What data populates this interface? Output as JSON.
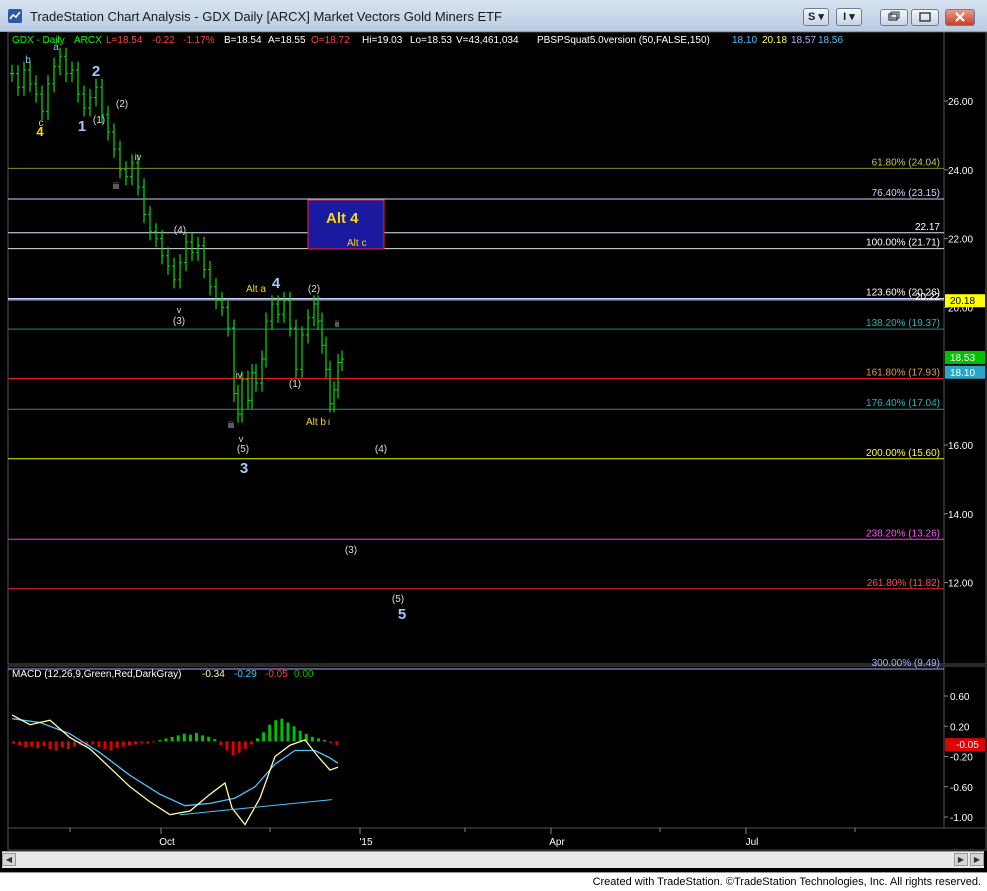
{
  "window": {
    "title": "TradeStation Chart Analysis - GDX Daily [ARCX] Market Vectors Gold Miners ETF",
    "btn_s": "S",
    "btn_i": "I"
  },
  "header": {
    "symbol": "GDX - Daily",
    "exchange": "ARCX",
    "last": "L=18.54",
    "change": "-0.22",
    "pct": "-1.17%",
    "bid": "B=18.54",
    "ask": "A=18.55",
    "open": "O=18.72",
    "high": "Hi=19.03",
    "low": "Lo=18.53",
    "volume": "V=43,461,034",
    "study": "PBSPSquat5.0version (50,FALSE,150)",
    "sv1": "18.10",
    "sv2": "20.18",
    "sv3": "18.57",
    "sv4": "18.56"
  },
  "macd_header": {
    "label": "MACD (12,26,9,Green,Red,DarkGray)",
    "v1": "-0.34",
    "v2": "-0.29",
    "v3": "-0.05",
    "v4": "0.00"
  },
  "price_axis": {
    "ticks": [
      {
        "label": "26.00",
        "value": 26
      },
      {
        "label": "24.00",
        "value": 24
      },
      {
        "label": "22.00",
        "value": 22
      },
      {
        "label": "20.00",
        "value": 20
      },
      {
        "label": "16.00",
        "value": 16
      },
      {
        "label": "14.00",
        "value": 14
      },
      {
        "label": "12.00",
        "value": 12
      }
    ],
    "tags": [
      {
        "label": "20.18",
        "value": 20.18,
        "bg": "#ffff00",
        "fg": "#000"
      },
      {
        "label": "18.53",
        "value": 18.53,
        "bg": "#00c000",
        "fg": "#fff"
      },
      {
        "label": "18.10",
        "value": 18.1,
        "bg": "#2aa6c8",
        "fg": "#fff"
      }
    ]
  },
  "macd_axis": {
    "ticks": [
      {
        "label": "0.60",
        "value": 0.6
      },
      {
        "label": "0.20",
        "value": 0.2
      },
      {
        "label": "-0.20",
        "value": -0.2
      },
      {
        "label": "-0.60",
        "value": -0.6
      },
      {
        "label": "-1.00",
        "value": -1.0
      }
    ],
    "tag": {
      "label": "-0.05",
      "value": -0.05
    }
  },
  "date_axis": [
    "Oct",
    "'15",
    "Apr",
    "Jul"
  ],
  "fib_levels": [
    {
      "label": "61.80% (24.04)",
      "value": 24.04,
      "color": "#8a8a2a",
      "text": "#c9c94a"
    },
    {
      "label": "76.40% (23.15)",
      "value": 23.15,
      "color": "#c8d2ff",
      "text": "#c8d2ff"
    },
    {
      "label": "22.17",
      "value": 22.17,
      "color": "#dfe6ff",
      "text": "#ffffff"
    },
    {
      "label": "100.00% (21.71)",
      "value": 21.71,
      "color": "#dddddd",
      "text": "#ffffff"
    },
    {
      "label": "123.60% (20.26)",
      "value": 20.26,
      "color": "#c8d2ff",
      "text": "#ffffff"
    },
    {
      "label": "20.22",
      "value": 20.22,
      "color": "#e6ecff",
      "text": "#ffffff"
    },
    {
      "label": "138.20% (19.37)",
      "value": 19.37,
      "color": "#2a8a8a",
      "text": "#2fb3b3"
    },
    {
      "label": "161.80% (17.93)",
      "value": 17.93,
      "color": "#ff2020",
      "text": "#d9a04a"
    },
    {
      "label": "176.40% (17.04)",
      "value": 17.04,
      "color": "#2a8a8a",
      "text": "#2fb3b3"
    },
    {
      "label": "200.00% (15.60)",
      "value": 15.6,
      "color": "#f0f000",
      "text": "#ffff40"
    },
    {
      "label": "238.20% (13.26)",
      "value": 13.26,
      "color": "#ff30ff",
      "text": "#ff50ff"
    },
    {
      "label": "261.80% (11.82)",
      "value": 11.82,
      "color": "#ff2020",
      "text": "#ff5050"
    },
    {
      "label": "300.00% (9.49)",
      "value": 9.49,
      "color": "#9fb0ff",
      "text": "#9fb0ff"
    }
  ],
  "wave_labels": [
    {
      "text": "4",
      "color": "#ffd700",
      "size": 13,
      "bold": true
    },
    {
      "text": "c",
      "color": "#ffd700",
      "size": 10,
      "bold": false
    },
    {
      "text": "b",
      "color": "#aab8ff",
      "size": 10,
      "bold": false
    },
    {
      "text": "a",
      "color": "#aab8ff",
      "size": 10,
      "bold": false
    },
    {
      "text": "1",
      "color": "#aac4ff",
      "size": 15,
      "bold": true
    },
    {
      "text": "2",
      "color": "#aac4ff",
      "size": 15,
      "bold": true
    },
    {
      "text": "(1)",
      "color": "#dddddd",
      "size": 10,
      "bold": false
    },
    {
      "text": "(2)",
      "color": "#dddddd",
      "size": 10,
      "bold": false
    },
    {
      "text": "iii",
      "color": "#dddddd",
      "size": 9,
      "bold": false
    },
    {
      "text": "iv",
      "color": "#dddddd",
      "size": 9,
      "bold": false
    },
    {
      "text": "(4)",
      "color": "#dddddd",
      "size": 10,
      "bold": false
    },
    {
      "text": "v",
      "color": "#dddddd",
      "size": 9,
      "bold": false
    },
    {
      "text": "(3)",
      "color": "#dddddd",
      "size": 10,
      "bold": false
    },
    {
      "text": "Alt a",
      "color": "#ffd700",
      "size": 10,
      "bold": false
    },
    {
      "text": "4",
      "color": "#aac4ff",
      "size": 15,
      "bold": true
    },
    {
      "text": "(2)",
      "color": "#dddddd",
      "size": 10,
      "bold": false
    },
    {
      "text": "ii",
      "color": "#dddddd",
      "size": 9,
      "bold": false
    },
    {
      "text": "iv",
      "color": "#dddddd",
      "size": 9,
      "bold": false
    },
    {
      "text": "(1)",
      "color": "#dddddd",
      "size": 10,
      "bold": false
    },
    {
      "text": "Alt b",
      "color": "#ffd700",
      "size": 10,
      "bold": false
    },
    {
      "text": "i",
      "color": "#dddddd",
      "size": 9,
      "bold": false
    },
    {
      "text": "iii",
      "color": "#dddddd",
      "size": 9,
      "bold": false
    },
    {
      "text": "v",
      "color": "#dddddd",
      "size": 9,
      "bold": false
    },
    {
      "text": "(5)",
      "color": "#dddddd",
      "size": 10,
      "bold": false
    },
    {
      "text": "3",
      "color": "#aac4ff",
      "size": 15,
      "bold": true
    },
    {
      "text": "(4)",
      "color": "#dddddd",
      "size": 10,
      "bold": false
    },
    {
      "text": "(3)",
      "color": "#dddddd",
      "size": 10,
      "bold": false
    },
    {
      "text": "(5)",
      "color": "#dddddd",
      "size": 10,
      "bold": false
    },
    {
      "text": "5",
      "color": "#aac4ff",
      "size": 15,
      "bold": true
    }
  ],
  "alt_box": {
    "title": "Alt 4",
    "sub": "Alt c",
    "bg": "#1a1aa0",
    "title_color": "#ffd700",
    "sub_color": "#ffd700"
  },
  "statusbar": "Created with TradeStation. ©TradeStation Technologies, Inc. All rights reserved.",
  "colors": {
    "up": "#00e000",
    "down": "#00e000",
    "macd": "#ffffa0",
    "signal": "#4fc3ff",
    "hist_pos": "#00c000",
    "hist_neg": "#e00000"
  }
}
